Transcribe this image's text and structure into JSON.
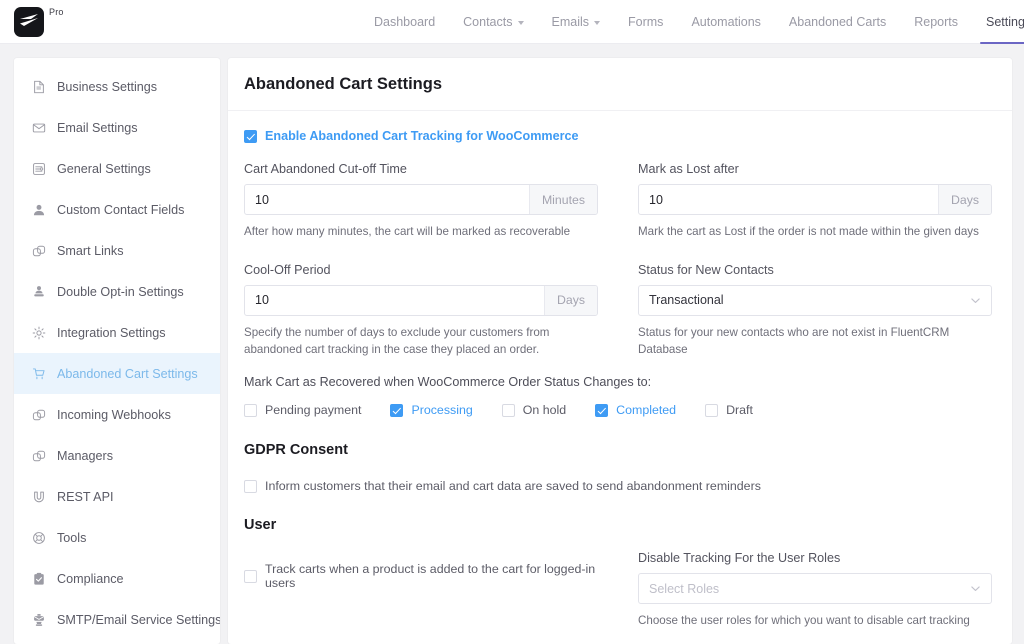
{
  "topbar": {
    "brand_label": "Pro",
    "logo_icon": "fluentcrm-bolt-logo",
    "nav": [
      {
        "label": "Dashboard",
        "has_caret": false,
        "active": false
      },
      {
        "label": "Contacts",
        "has_caret": true,
        "active": false
      },
      {
        "label": "Emails",
        "has_caret": true,
        "active": false
      },
      {
        "label": "Forms",
        "has_caret": false,
        "active": false
      },
      {
        "label": "Automations",
        "has_caret": false,
        "active": false
      },
      {
        "label": "Abandoned Carts",
        "has_caret": false,
        "active": false
      },
      {
        "label": "Reports",
        "has_caret": false,
        "active": false
      },
      {
        "label": "Settings",
        "has_caret": false,
        "active": true
      }
    ]
  },
  "sidebar": {
    "items": [
      {
        "label": "Business Settings",
        "icon": "document-icon",
        "active": false
      },
      {
        "label": "Email Settings",
        "icon": "envelope-icon",
        "active": false
      },
      {
        "label": "General Settings",
        "icon": "sliders-list-icon",
        "active": false
      },
      {
        "label": "Custom Contact Fields",
        "icon": "user-icon",
        "active": false
      },
      {
        "label": "Smart Links",
        "icon": "link-chain-icon",
        "active": false
      },
      {
        "label": "Double Opt-in Settings",
        "icon": "user-stamp-icon",
        "active": false
      },
      {
        "label": "Integration Settings",
        "icon": "gear-icon",
        "active": false
      },
      {
        "label": "Abandoned Cart Settings",
        "icon": "shopping-cart-icon",
        "active": true
      },
      {
        "label": "Incoming Webhooks",
        "icon": "link-chain-icon",
        "active": false
      },
      {
        "label": "Managers",
        "icon": "link-chain-icon",
        "active": false
      },
      {
        "label": "REST API",
        "icon": "magnet-icon",
        "active": false
      },
      {
        "label": "Tools",
        "icon": "lifebuoy-icon",
        "active": false
      },
      {
        "label": "Compliance",
        "icon": "clipboard-check-icon",
        "active": false
      },
      {
        "label": "SMTP/Email Service Settings",
        "icon": "mail-service-icon",
        "active": false
      }
    ]
  },
  "main": {
    "title": "Abandoned Cart Settings",
    "enable_tracking": {
      "label": "Enable Abandoned Cart Tracking for WooCommerce",
      "checked": true
    },
    "cutoff_time": {
      "label": "Cart Abandoned Cut-off Time",
      "value": "10",
      "unit": "Minutes",
      "help": "After how many minutes, the cart will be marked as recoverable"
    },
    "mark_lost": {
      "label": "Mark as Lost after",
      "value": "10",
      "unit": "Days",
      "help": "Mark the cart as Lost if the order is not made within the given days"
    },
    "cool_off": {
      "label": "Cool-Off Period",
      "value": "10",
      "unit": "Days",
      "help": "Specify the number of days to exclude your customers from abandoned cart tracking in the case they placed an order."
    },
    "new_contact_status": {
      "label": "Status for New Contacts",
      "value": "Transactional",
      "help": "Status for your new contacts who are not exist in FluentCRM Database",
      "options": [
        "Transactional"
      ]
    },
    "recovered_status": {
      "label": "Mark Cart as Recovered when WooCommerce Order Status Changes to:",
      "options": [
        {
          "label": "Pending payment",
          "checked": false
        },
        {
          "label": "Processing",
          "checked": true
        },
        {
          "label": "On hold",
          "checked": false
        },
        {
          "label": "Completed",
          "checked": true
        },
        {
          "label": "Draft",
          "checked": false
        }
      ]
    },
    "gdpr": {
      "title": "GDPR Consent",
      "consent": {
        "label": "Inform customers that their email and cart data are saved to send abandonment reminders",
        "checked": false
      }
    },
    "user": {
      "title": "User",
      "track_logged_in": {
        "label": "Track carts when a product is added to the cart for logged-in users",
        "checked": false
      },
      "disable_roles": {
        "label": "Disable Tracking For the User Roles",
        "placeholder": "Select Roles",
        "value": "",
        "help": "Choose the user roles for which you want to disable cart tracking"
      }
    }
  },
  "colors": {
    "accent_blue": "#3e9bf4",
    "nav_active_underline": "#6b66c4",
    "sidebar_active_bg": "#eaf4fd",
    "page_bg": "#f2f2f4"
  }
}
